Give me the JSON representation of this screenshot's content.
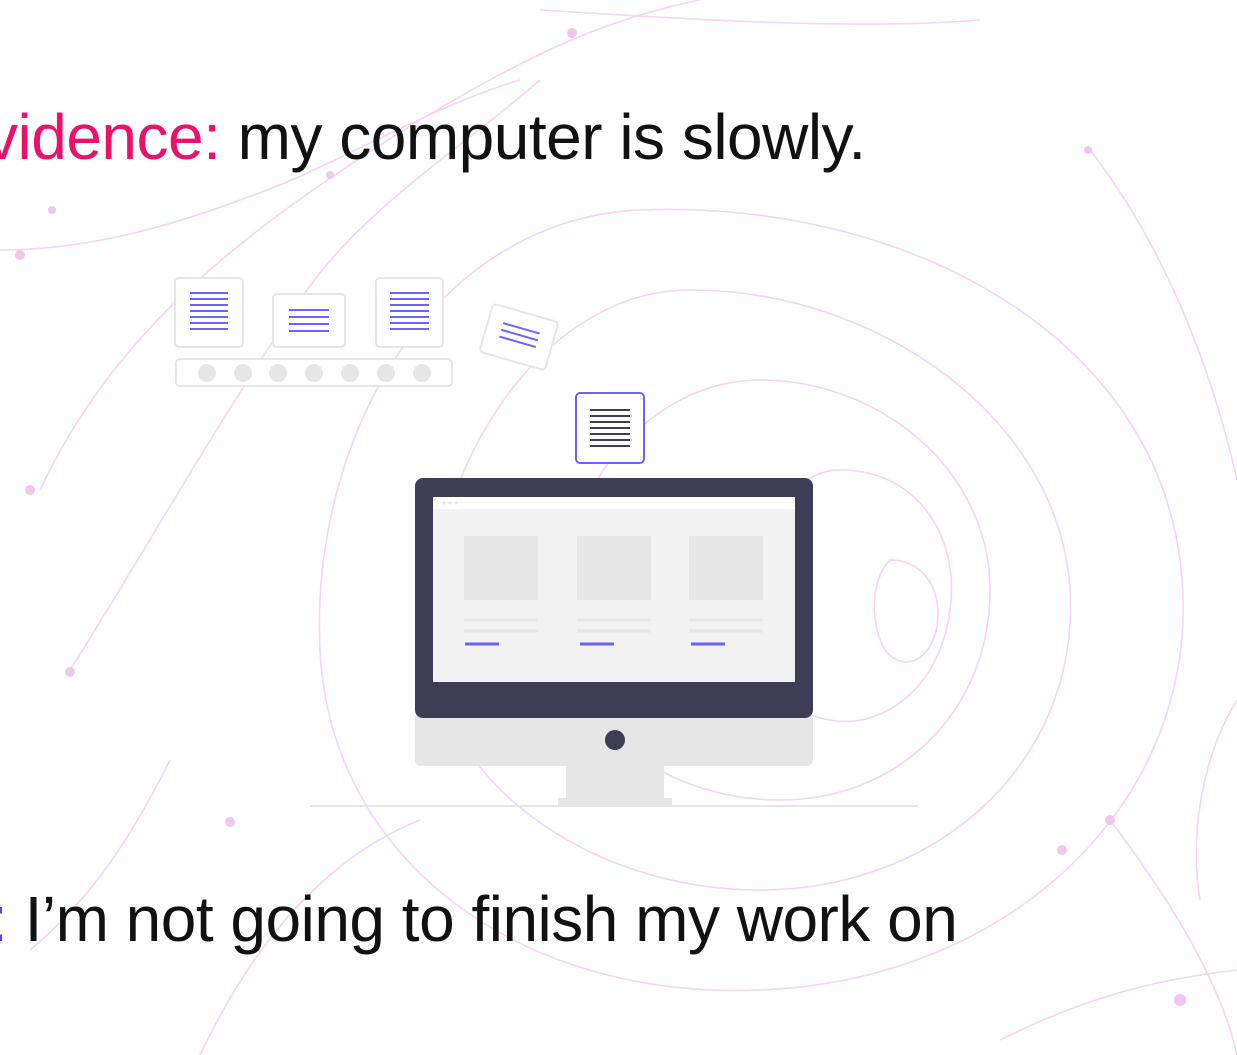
{
  "line1": {
    "label": "vidence:",
    "text": " my computer is slowly."
  },
  "line2": {
    "label": ":",
    "text": " I’m not going to finish my work on"
  },
  "colors": {
    "label_pink": "#ec0f6b",
    "label_purple": "#5b3df5",
    "text": "#111111",
    "monitor_frame": "#3f3d56",
    "screen_bg": "#f2f2f2",
    "placeholder": "#e6e6e6",
    "accent_line": "#6c63ff",
    "background_lines": "#f3d6f0"
  },
  "illustration": {
    "icons": [
      "document-icon",
      "document-icon",
      "document-icon",
      "tilted-document-icon",
      "document-icon"
    ],
    "monitor_content_cards": 3
  }
}
